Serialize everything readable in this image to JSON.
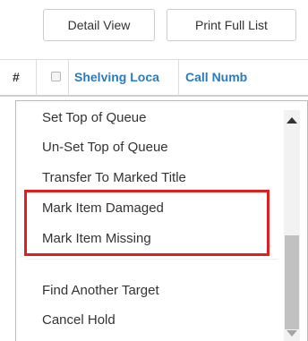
{
  "toolbar": {
    "detail_view_label": "Detail View",
    "print_full_list_label": "Print Full List"
  },
  "table_header": {
    "hash": "#",
    "shelving_location": "Shelving Locatio",
    "call_number": "Call Numb",
    "accent_color": "#2b7bbf"
  },
  "menu": {
    "items": [
      {
        "label": "Set Top of Queue"
      },
      {
        "label": "Un-Set Top of Queue"
      },
      {
        "label": "Transfer To Marked Title"
      },
      {
        "label": "Mark Item Damaged"
      },
      {
        "label": "Mark Item Missing"
      },
      {
        "label": "Find Another Target"
      },
      {
        "label": "Cancel Hold"
      }
    ]
  },
  "annotation": {
    "highlight_color": "#e01e1e",
    "highlighted_items": [
      "Mark Item Damaged",
      "Mark Item Missing"
    ]
  }
}
